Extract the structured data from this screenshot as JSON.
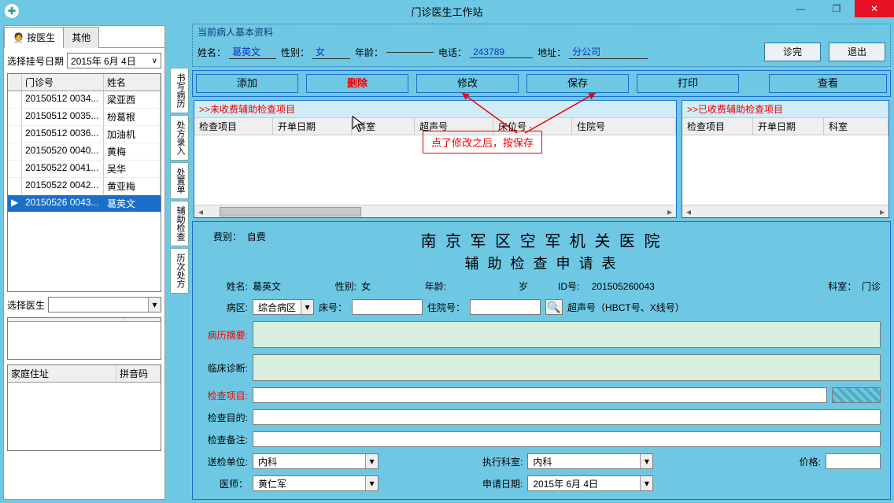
{
  "window": {
    "title": "门诊医生工作站"
  },
  "tabs": {
    "byDoctor": "按医生",
    "other": "其他"
  },
  "left": {
    "dateLabel": "选择挂号日期",
    "dateValue": "2015年 6月 4日",
    "cols": {
      "blank": "",
      "id": "门诊号",
      "name": "姓名"
    },
    "rows": [
      {
        "id": "20150512 0034...",
        "name": "梁亚西"
      },
      {
        "id": "20150512 0035...",
        "name": "枌葛根"
      },
      {
        "id": "20150512 0036...",
        "name": "加油机"
      },
      {
        "id": "20150520 0040...",
        "name": "黄梅"
      },
      {
        "id": "20150522 0041...",
        "name": "吴华"
      },
      {
        "id": "20150522 0042...",
        "name": "黄亚梅"
      },
      {
        "id": "20150526 0043...",
        "name": "葛英文"
      }
    ],
    "selectDoctorLabel": "选择医生",
    "grid3cols": {
      "c1": "家庭住址",
      "c2": "拼音码"
    }
  },
  "vtabs": [
    "书写病历",
    "处方录入",
    "处置单",
    "辅助检查",
    "历次处方"
  ],
  "patient": {
    "legend": "当前病人基本资料",
    "nameLabel": "姓名：",
    "name": "葛英文",
    "sexLabel": "性别：",
    "sex": "女",
    "ageLabel": "年龄：",
    "age": "",
    "phoneLabel": "电话：",
    "phone": "243789",
    "addrLabel": "地址：",
    "addr": "分公司",
    "finishBtn": "诊完",
    "exitBtn": "退出"
  },
  "actions": {
    "add": "添加",
    "delete": "删除",
    "modify": "修改",
    "save": "保存",
    "print": "打印",
    "view": "查看"
  },
  "tbl1": {
    "title": ">>未收费辅助检查项目",
    "cols": [
      "检查项目",
      "开单日期",
      "科室",
      "超声号",
      "床位号  ·",
      "住院号"
    ]
  },
  "tbl2": {
    "title": ">>已收费辅助检查项目",
    "cols": [
      "检查项目",
      "开单日期",
      "科室"
    ]
  },
  "annotation": "点了修改之后，按保存",
  "form": {
    "feeTypeLabel": "费别：",
    "feeType": "自费",
    "hospital": "南 京 军 区 空 军 机 关 医 院",
    "subtitle": "辅 助 检 查 申 请 表",
    "name_l": "姓名:",
    "name": "葛英文",
    "sex_l": "性别:",
    "sex": "女",
    "age_l": "年龄:",
    "age_suffix": "岁",
    "id_l": "ID号:",
    "id": "201505260043",
    "dept_l": "科室：",
    "dept": "门诊",
    "ward_l": "病区:",
    "ward": "综合病区",
    "bed_l": "床号：",
    "inhosp_l": "住院号：",
    "ultra_l": "超声号（HBCT号、X线号）",
    "summary_l": "病历摘要:",
    "diag_l": "临床诊断:",
    "items_l": "检查项目:",
    "purpose_l": "检查目的:",
    "notes_l": "检查备注:",
    "sendUnit_l": "送检单位:",
    "sendUnit": "内科",
    "execDept_l": "执行科室:",
    "execDept": "内科",
    "price_l": "价格:",
    "doctor_l": "医师：",
    "doctor": "黄仁军",
    "applyDate_l": "申请日期:",
    "applyDate": "2015年 6月 4日"
  }
}
